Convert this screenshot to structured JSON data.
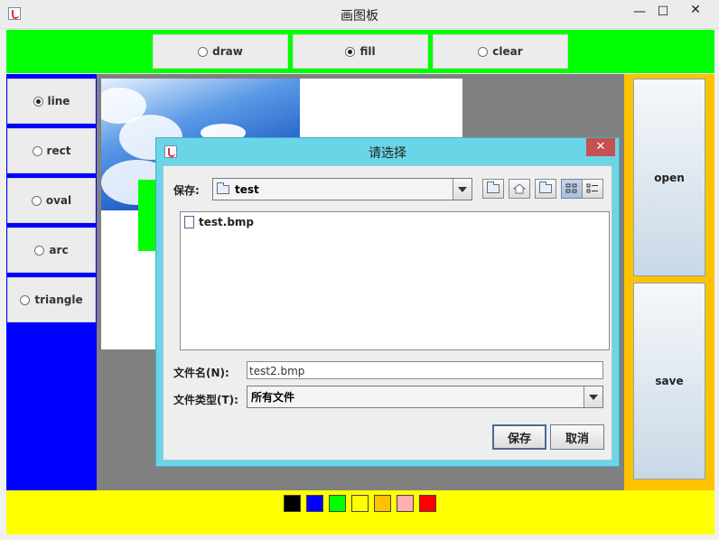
{
  "window": {
    "title": "画图板",
    "minimize_glyph": "—",
    "maximize_glyph": "☐",
    "close_glyph": "✕"
  },
  "mode_options": [
    {
      "label": "draw",
      "selected": false
    },
    {
      "label": "fill",
      "selected": true
    },
    {
      "label": "clear",
      "selected": false
    }
  ],
  "shape_options": [
    {
      "label": "line",
      "selected": true
    },
    {
      "label": "rect",
      "selected": false
    },
    {
      "label": "oval",
      "selected": false
    },
    {
      "label": "arc",
      "selected": false
    },
    {
      "label": "triangle",
      "selected": false
    }
  ],
  "side_buttons": {
    "open": "open",
    "save": "save"
  },
  "palette": [
    "#000000",
    "#0000ff",
    "#00ff00",
    "#ffff00",
    "#ffc200",
    "#ffafaf",
    "#ff0000"
  ],
  "colors": {
    "top_panel": "#00ff00",
    "left_panel": "#0000ff",
    "right_panel": "#ffc200",
    "bottom_panel": "#ffff00",
    "canvas_bg": "#808080",
    "dialog_frame": "#6ad5e6"
  },
  "dialog": {
    "title": "请选择",
    "close_glyph": "✕",
    "save_in_label": "保存:",
    "save_in_value": "test",
    "toolbar_icons": [
      "up-folder-icon",
      "home-icon",
      "new-folder-icon",
      "list-view-icon",
      "details-view-icon"
    ],
    "files": [
      {
        "name": "test.bmp"
      }
    ],
    "filename_label": "文件名(N):",
    "filename_value": "test2.bmp",
    "filetype_label": "文件类型(T):",
    "filetype_value": "所有文件",
    "save_button": "保存",
    "cancel_button": "取消"
  }
}
